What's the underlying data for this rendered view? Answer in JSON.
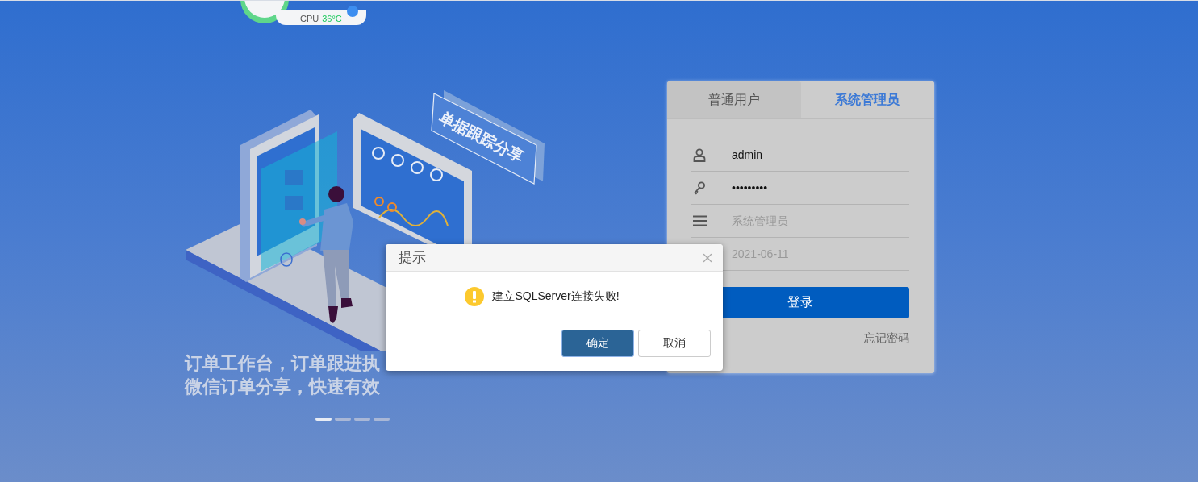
{
  "system_monitor": {
    "label": "CPU",
    "temperature": "36°C"
  },
  "illustration": {
    "sign": "单据跟踪分享"
  },
  "slogan": [
    "订单工作台，订单跟进执",
    "微信订单分享，快速有效"
  ],
  "carousel": [
    {
      "selected": true
    },
    {
      "selected": false
    },
    {
      "selected": false
    },
    {
      "selected": false
    }
  ],
  "login": {
    "tabs": [
      {
        "label": "普通用户",
        "selected": false
      },
      {
        "label": "系统管理员",
        "selected": true
      }
    ],
    "fields": [
      {
        "kind": "user",
        "value": "admin"
      },
      {
        "kind": "password",
        "value": "•••••••••"
      },
      {
        "kind": "role",
        "placeholder": "系统管理员"
      },
      {
        "kind": "date",
        "placeholder": "2021-06-11"
      }
    ],
    "submit": "登录",
    "forgot": "忘记密码"
  },
  "dialog": {
    "title": "提示",
    "message": "建立SQLServer连接失败!",
    "buttons": [
      {
        "label": "确定",
        "primary": true
      },
      {
        "label": "取消",
        "primary": false
      }
    ]
  }
}
